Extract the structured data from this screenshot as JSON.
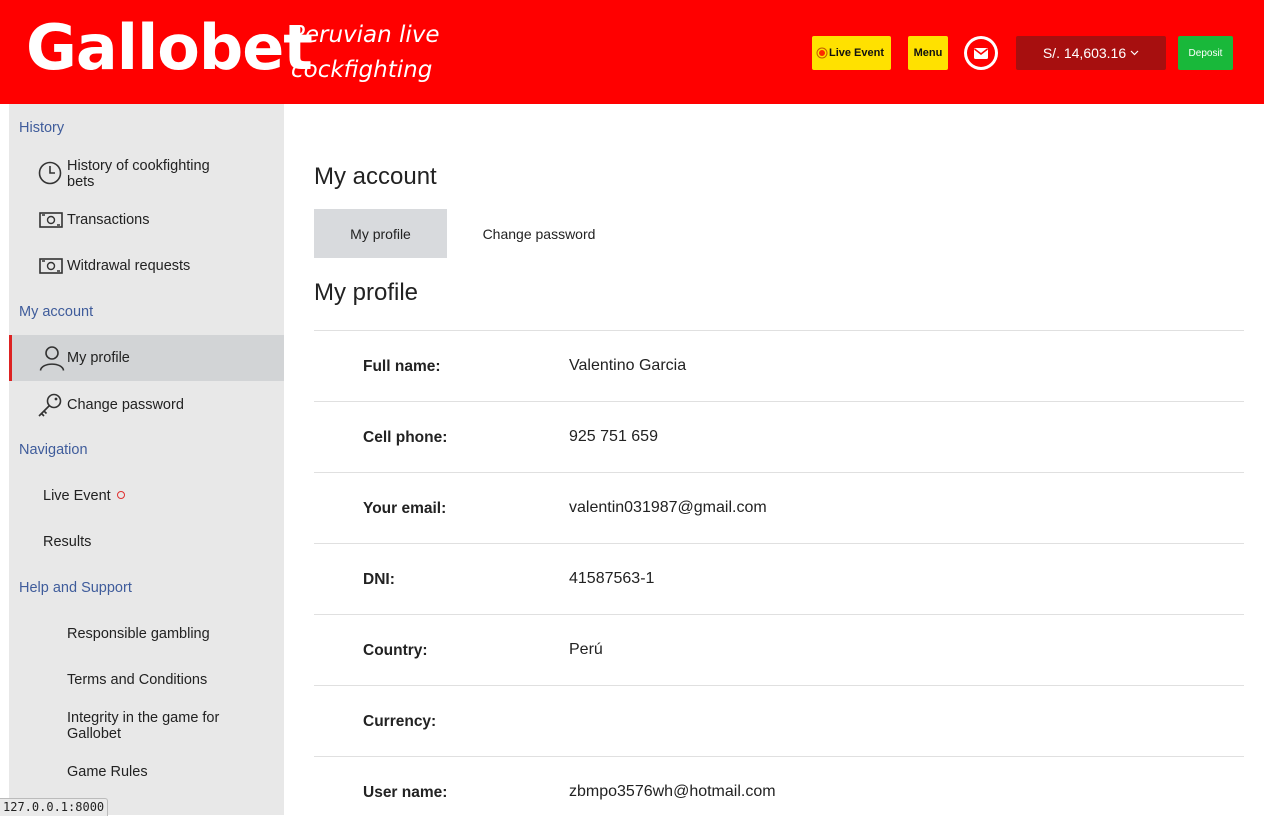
{
  "brand": {
    "logo": "Gallobet",
    "tagline": "Peruvian live cockfighting"
  },
  "header": {
    "live_event": "Live Event",
    "menu": "Menu",
    "balance": "S/. 14,603.16",
    "deposit": "Deposit"
  },
  "sidebar": {
    "history_heading": "History",
    "history_items": [
      {
        "label": "History of cookfighting bets",
        "icon": "clock-icon"
      },
      {
        "label": "Transactions",
        "icon": "cash-icon"
      },
      {
        "label": "Witdrawal requests",
        "icon": "cash-icon"
      }
    ],
    "account_heading": "My account",
    "account_items": [
      {
        "label": "My profile",
        "icon": "user-icon",
        "active": true
      },
      {
        "label": "Change password",
        "icon": "key-icon"
      }
    ],
    "nav_heading": "Navigation",
    "nav_items": [
      {
        "label": "Live Event"
      },
      {
        "label": "Results"
      }
    ],
    "help_heading": "Help and Support",
    "help_items": [
      {
        "label": "Responsible gambling"
      },
      {
        "label": "Terms and Conditions"
      },
      {
        "label": "Integrity in the game for Gallobet"
      },
      {
        "label": "Game Rules"
      }
    ]
  },
  "main": {
    "title": "My account",
    "tabs": [
      {
        "label": "My profile",
        "active": true
      },
      {
        "label": "Change password"
      }
    ],
    "section_title": "My profile",
    "fields": [
      {
        "key": "Full name:",
        "value": "Valentino Garcia"
      },
      {
        "key": "Cell phone:",
        "value": "925 751 659"
      },
      {
        "key": "Your email:",
        "value": "valentin031987@gmail.com"
      },
      {
        "key": "DNI:",
        "value": "41587563-1"
      },
      {
        "key": "Country:",
        "value": "Perú"
      },
      {
        "key": "Currency:",
        "value": ""
      },
      {
        "key": "User name:",
        "value": "zbmpo3576wh@hotmail.com"
      }
    ]
  },
  "status_bar": {
    "url": "127.0.0.1:8000"
  },
  "colors": {
    "header": "#ff0000",
    "accent_yellow": "#ffe100",
    "deposit": "#19b83a",
    "balance": "#a70f0f",
    "sidebar_heading": "#3f5c9b"
  }
}
